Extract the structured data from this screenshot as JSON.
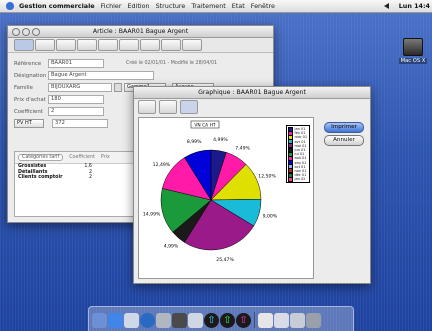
{
  "menubar": {
    "app": "Gestion commerciale",
    "items": [
      "Fichier",
      "Edition",
      "Structure",
      "Traitement",
      "Etat",
      "Fenêtre"
    ],
    "clock": "Lun 14:4"
  },
  "desktop": {
    "drive_label": "Mac OS X"
  },
  "article_window": {
    "title": "Article : BAAR01 Bague Argent",
    "fields": [
      {
        "label": "Référence",
        "value": "BAAR01",
        "note": "Créé le 02/01/01 - Modifié le 28/04/01"
      },
      {
        "label": "Désignation",
        "value": "Bague Argent"
      },
      {
        "label": "Famille",
        "value": "BIJOUXARG",
        "extra_label": "Gamme1",
        "extra_value": "Aucune"
      },
      {
        "label": "Prix d'achat",
        "value": "180"
      },
      {
        "label": "Coefficient",
        "value": "2"
      },
      {
        "label": "PV HT",
        "value": "372"
      }
    ],
    "sub_tab": "Catégories tarif",
    "sub_cols": [
      "Coefficient",
      "Prix"
    ],
    "price_rows": [
      {
        "name": "Grossistes",
        "value": "1,6"
      },
      {
        "name": "Détaillants",
        "value": "2"
      },
      {
        "name": "Clients comptoir",
        "value": "2"
      }
    ]
  },
  "graph_window": {
    "title": "Graphique : BAAR01 Bague Argent",
    "buttons": {
      "print": "Imprimer",
      "cancel": "Annuler"
    }
  },
  "colors": {
    "menubar_accent": "#3a6ed8",
    "default_button": "#3f74d6"
  },
  "chart_data": {
    "type": "pie",
    "title": "",
    "inner_label": "VN CA HT",
    "legend": [
      "jan 01",
      "fév 01",
      "mar 01",
      "avr 01",
      "mai 01",
      "jun 01",
      "jul 01",
      "aoû 01",
      "sep 01",
      "oct 01",
      "nov 01",
      "déc 01",
      "jan 02"
    ],
    "categories": [
      "jan 01",
      "fév 01",
      "mar 01",
      "avr 01",
      "mai 01",
      "jun 01",
      "jul 01",
      "aoû 01",
      "sep 01",
      "oct 01",
      "nov 01",
      "déc 01",
      "jan 02"
    ],
    "values": [
      4.99,
      7.49,
      12.5,
      9.0,
      25.47,
      4.99,
      14.99,
      12.49,
      8.99,
      0,
      0,
      0,
      0
    ],
    "value_labels": [
      "4,99%",
      "7,49%",
      "12,50%",
      "9,00%",
      "25,47%",
      "4,99%",
      "14,99%",
      "12,49%",
      "8,99%"
    ],
    "colors": [
      "#1a1a8a",
      "#ff1aa8",
      "#e0e000",
      "#1abbd8",
      "#9a1a8a",
      "#1a1a1a",
      "#1a9a3a",
      "#ff1aa8",
      "#0000d8",
      "#8ab3ff",
      "#bb2222",
      "#1a7a3a",
      "#ff3a9a"
    ],
    "legend_position": "right"
  }
}
